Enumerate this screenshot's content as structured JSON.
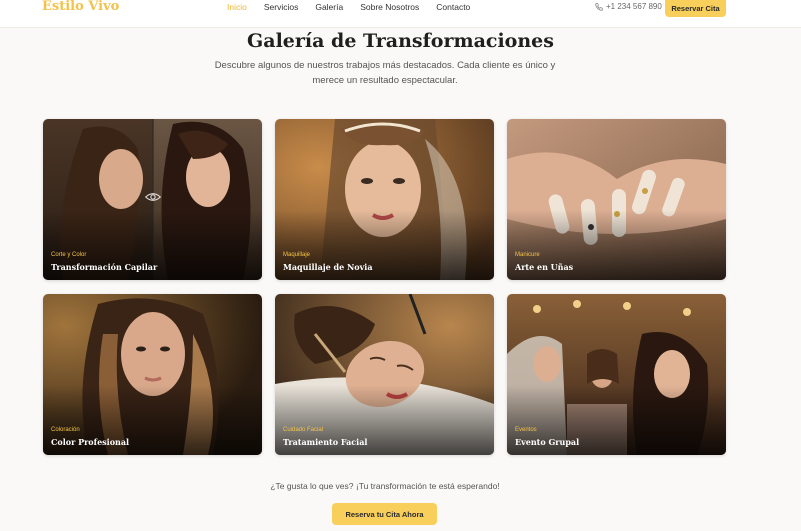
{
  "header": {
    "logo": "Estilo Vivo",
    "nav": [
      "Inicio",
      "Servicios",
      "Galería",
      "Sobre Nosotros",
      "Contacto"
    ],
    "phone": "+1 234 567 890",
    "reserve_label": "Reservar Cita"
  },
  "gallery": {
    "title": "Galería de Transformaciones",
    "subtitle": "Descubre algunos de nuestros trabajos más destacados. Cada cliente es único y merece un resultado espectacular.",
    "items": [
      {
        "category": "Corte y Color",
        "title": "Transformación Capilar"
      },
      {
        "category": "Maquillaje",
        "title": "Maquillaje de Novia"
      },
      {
        "category": "Manicure",
        "title": "Arte en Uñas"
      },
      {
        "category": "Coloración",
        "title": "Color Profesional"
      },
      {
        "category": "Cuidado Facial",
        "title": "Tratamiento Facial"
      },
      {
        "category": "Eventos",
        "title": "Evento Grupal"
      }
    ]
  },
  "cta": {
    "text": "¿Te gusta lo que ves? ¡Tu transformación te está esperando!",
    "button": "Reserva tu Cita Ahora"
  },
  "colors": {
    "accent": "#f8cf5a",
    "active_nav": "#f0b82e",
    "category_text": "#f6c448"
  }
}
